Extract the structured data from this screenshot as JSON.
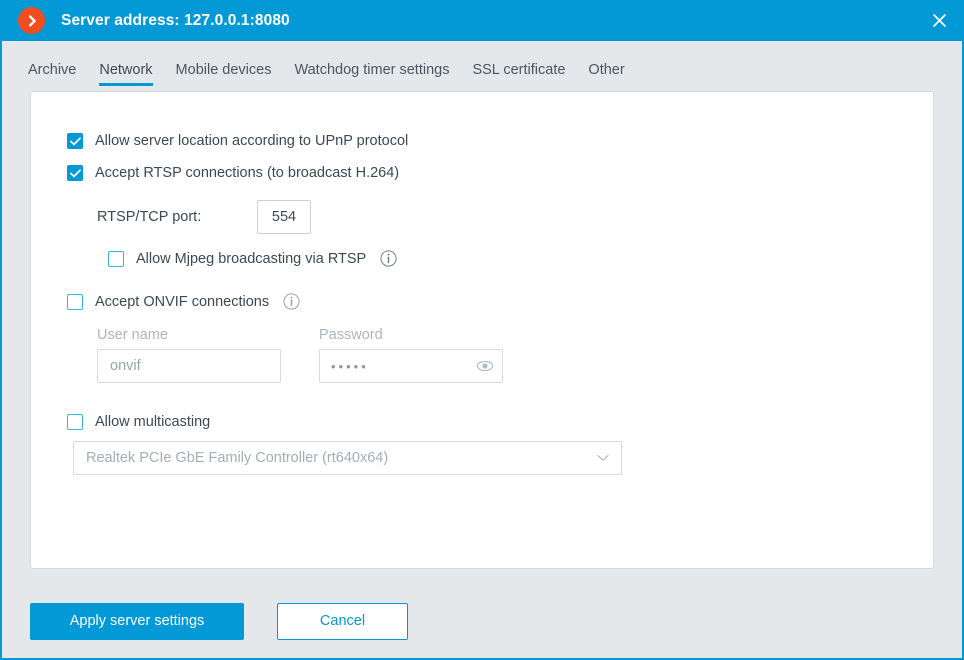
{
  "titlebar": {
    "logo_icon": "chevron-right-circle-icon",
    "title": "Server address: 127.0.0.1:8080",
    "close_icon": "close-icon",
    "background_color": "#0399d7",
    "logo_color": "#f04d21"
  },
  "tabs": [
    {
      "label": "Archive",
      "active": false
    },
    {
      "label": "Network",
      "active": true
    },
    {
      "label": "Mobile devices",
      "active": false
    },
    {
      "label": "Watchdog timer settings",
      "active": false
    },
    {
      "label": "SSL certificate",
      "active": false
    },
    {
      "label": "Other",
      "active": false
    }
  ],
  "form": {
    "upnp": {
      "label": "Allow server location according to UPnP protocol",
      "checked": true
    },
    "rtsp": {
      "label": "Accept RTSP connections (to broadcast H.264)",
      "checked": true
    },
    "rtsp_port": {
      "label": "RTSP/TCP port:",
      "value": "554"
    },
    "mjpeg": {
      "label": "Allow Mjpeg broadcasting via RTSP",
      "checked": false,
      "info_icon": "info-icon"
    },
    "onvif": {
      "label": "Accept ONVIF connections",
      "checked": false,
      "info_icon": "info-icon",
      "user_label": "User name",
      "user_value": "onvif",
      "password_label": "Password",
      "password_value": "•••••",
      "reveal_icon": "eye-icon"
    },
    "multicast": {
      "label": "Allow multicasting",
      "checked": false,
      "adapter_value": "Realtek PCIe GbE Family Controller (rt640x64)",
      "dropdown_icon": "chevron-down-icon"
    }
  },
  "footer": {
    "apply_label": "Apply server settings",
    "cancel_label": "Cancel",
    "accent_color": "#0399d7"
  }
}
